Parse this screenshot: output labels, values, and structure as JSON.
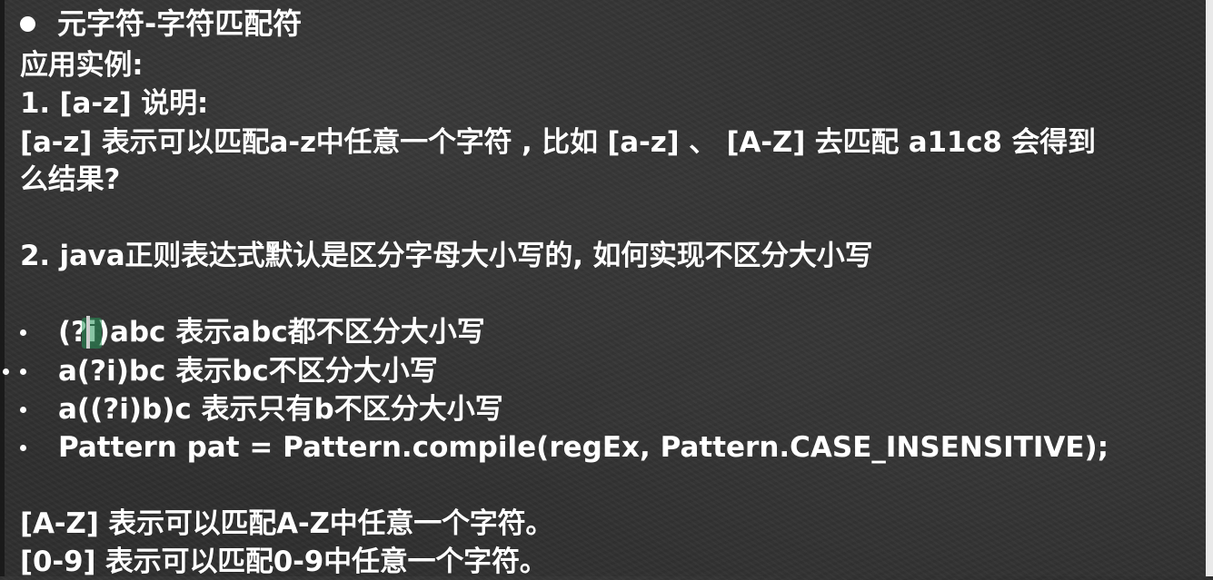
{
  "slide": {
    "title": "元字符-字符匹配符",
    "intro": "应用实例:",
    "item1_heading": "1.  [a-z] 说明:",
    "item1_desc_line1": "[a-z] 表示可以匹配a-z中任意一个字符 , 比如 [a-z] 、 [A-Z] 去匹配 a11c8  会得到",
    "item1_desc_line2": "么结果?",
    "item2_heading": "2.  java正则表达式默认是区分字母大小写的, 如何实现不区分大小写",
    "bullets": [
      "(?i)abc 表示abc都不区分大小写",
      "a(?i)bc 表示bc不区分大小写",
      "a((?i)b)c 表示只有b不区分大小写",
      "Pattern pat = Pattern.compile(regEx, Pattern.CASE_INSENSITIVE);"
    ],
    "footer_line1": "[A-Z] 表示可以匹配A-Z中任意一个字符。",
    "footer_line2": "[0-9] 表示可以匹配0-9中任意一个字符。"
  },
  "colors": {
    "background": "#2f2f2f",
    "text": "#ffffff",
    "cursor_highlight": "#2f9a5f"
  },
  "icons": {
    "title_bullet": "filled-circle-bullet",
    "list_bullet": "small-dot-bullet"
  }
}
